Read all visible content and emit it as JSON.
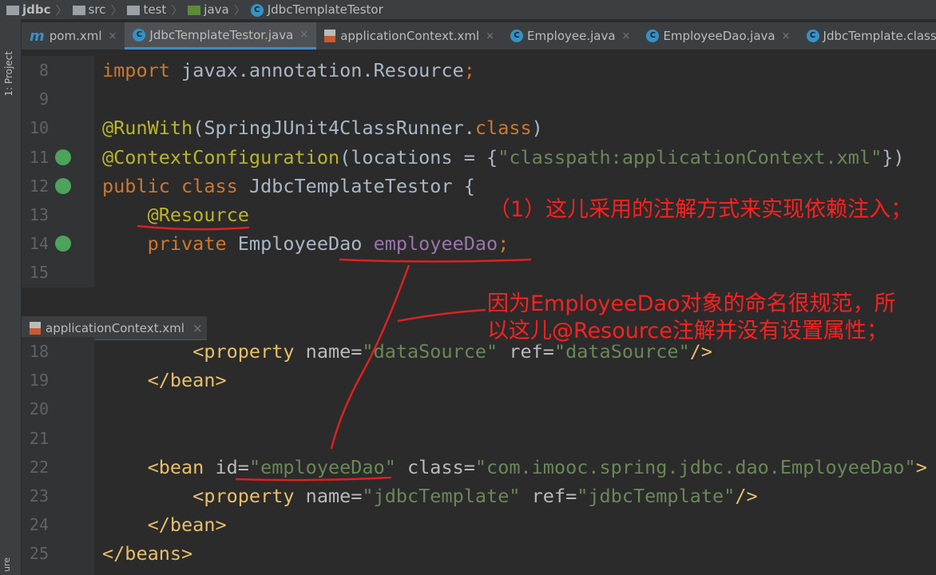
{
  "breadcrumb": [
    "jdbc",
    "src",
    "test",
    "java",
    "JdbcTemplateTestor"
  ],
  "sidebar": {
    "label": "1: Project",
    "bottom_label": "ure"
  },
  "tabs": [
    {
      "label": "pom.xml",
      "icon": "maven-icon"
    },
    {
      "label": "JdbcTemplateTestor.java",
      "icon": "class-icon",
      "active": true
    },
    {
      "label": "applicationContext.xml",
      "icon": "xml-icon"
    },
    {
      "label": "Employee.java",
      "icon": "class-icon"
    },
    {
      "label": "EmployeeDao.java",
      "icon": "class-icon"
    },
    {
      "label": "JdbcTemplate.class",
      "icon": "class-icon"
    }
  ],
  "editor1": [
    {
      "n": "8",
      "t": [
        [
          "kw",
          "import "
        ],
        [
          "tx",
          "javax.annotation.Resource"
        ],
        [
          "kw",
          ";"
        ]
      ]
    },
    {
      "n": "9",
      "t": []
    },
    {
      "n": "10",
      "t": [
        [
          "an",
          "@RunWith"
        ],
        [
          "tx",
          "(SpringJUnit4ClassRunner."
        ],
        [
          "kw",
          "class"
        ],
        [
          "tx",
          ")"
        ]
      ]
    },
    {
      "n": "11",
      "g": "spring",
      "t": [
        [
          "an",
          "@ContextConfiguration"
        ],
        [
          "tx",
          "(locations = {"
        ],
        [
          "st",
          "\"classpath:applicationContext.xml\""
        ],
        [
          "tx",
          "})"
        ]
      ]
    },
    {
      "n": "12",
      "g": "run",
      "t": [
        [
          "kw",
          "public class "
        ],
        [
          "tx",
          "JdbcTemplateTestor {"
        ]
      ]
    },
    {
      "n": "13",
      "t": [
        [
          "tx",
          "    "
        ],
        [
          "an",
          "@Resource"
        ]
      ]
    },
    {
      "n": "14",
      "g": "bean",
      "t": [
        [
          "kw",
          "    private "
        ],
        [
          "tx",
          "EmployeeDao "
        ],
        [
          "fd",
          "employeeDao"
        ],
        [
          "kw",
          ";"
        ]
      ]
    },
    {
      "n": "15",
      "t": []
    }
  ],
  "second_tab": "applicationContext.xml",
  "editor2": [
    {
      "n": "18",
      "t": [
        [
          "tx",
          "        "
        ],
        [
          "tg",
          "<property "
        ],
        [
          "at",
          "name="
        ],
        [
          "st",
          "\"dataSource\" "
        ],
        [
          "at",
          "ref="
        ],
        [
          "st",
          "\"dataSource\""
        ],
        [
          "tg",
          "/>"
        ]
      ]
    },
    {
      "n": "19",
      "t": [
        [
          "tg",
          "    </bean>"
        ]
      ]
    },
    {
      "n": "20",
      "t": []
    },
    {
      "n": "21",
      "t": []
    },
    {
      "n": "22",
      "t": [
        [
          "tg",
          "    <bean "
        ],
        [
          "at",
          "id="
        ],
        [
          "st",
          "\"employeeDao\" "
        ],
        [
          "at",
          "class="
        ],
        [
          "st",
          "\"com.imooc.spring.jdbc.dao.EmployeeDao\""
        ],
        [
          "tg",
          ">"
        ]
      ]
    },
    {
      "n": "23",
      "t": [
        [
          "tg",
          "        <property "
        ],
        [
          "at",
          "name="
        ],
        [
          "st",
          "\"jdbcTemplate\" "
        ],
        [
          "at",
          "ref="
        ],
        [
          "st",
          "\"jdbcTemplate\""
        ],
        [
          "tg",
          "/>"
        ]
      ]
    },
    {
      "n": "24",
      "t": [
        [
          "tg",
          "    </bean>"
        ]
      ]
    },
    {
      "n": "25",
      "t": [
        [
          "tg",
          "</beans>"
        ]
      ]
    }
  ],
  "annotations": {
    "note1": "（1）这儿采用的注解方式来实现依赖注入；",
    "note2": "因为EmployeeDao对象的命名很规范，所以这儿@Resource注解并没有设置属性；"
  },
  "colors": {
    "annotation_red": "#ff2020",
    "accent": "#4a88c7"
  }
}
